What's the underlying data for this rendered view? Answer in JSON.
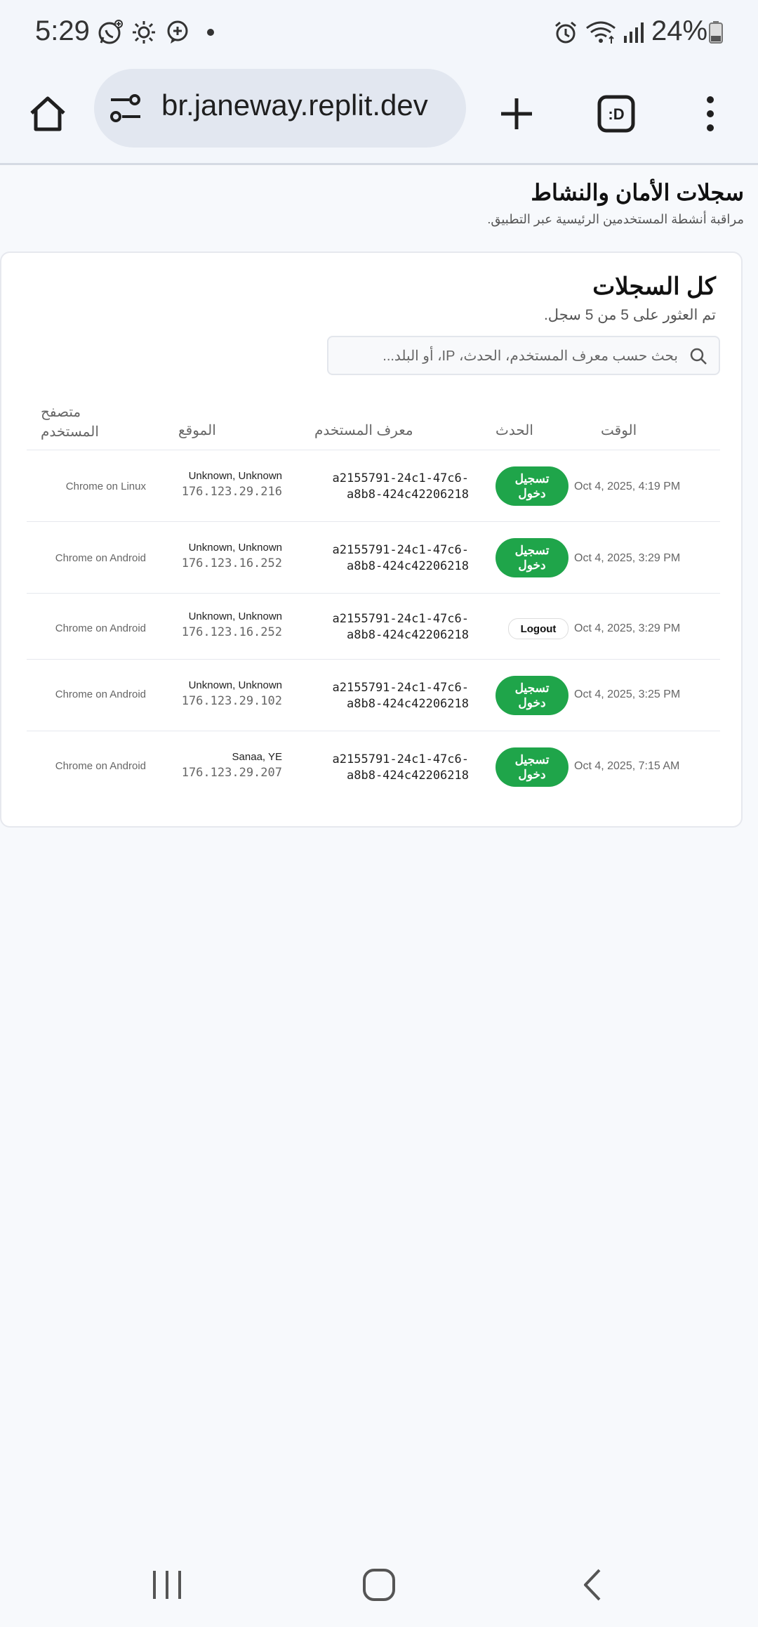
{
  "status_bar": {
    "time": "5:29",
    "battery": "24%",
    "icons": [
      "whatsapp-icon",
      "brightness-icon",
      "chat-plus-icon",
      "dot-icon",
      "alarm-icon",
      "wifi-icon",
      "signal-icon",
      "battery-icon"
    ]
  },
  "browser": {
    "url": "br.janeway.replit.dev",
    "icons": [
      "home-icon",
      "site-settings-icon",
      "new-tab-icon",
      "tab-switcher-icon",
      "more-menu-icon"
    ]
  },
  "page": {
    "title": "سجلات الأمان والنشاط",
    "subtitle": "مراقبة أنشطة المستخدمين الرئيسية عبر التطبيق."
  },
  "card": {
    "title": "كل السجلات",
    "description": "تم العثور على 5 من 5 سجل.",
    "search_placeholder": "بحث حسب معرف المستخدم، الحدث، IP، أو البلد..."
  },
  "table": {
    "headers": {
      "time": "الوقت",
      "event": "الحدث",
      "user_id": "معرف المستخدم",
      "location": "الموقع",
      "browser_line1": "متصفح",
      "browser_line2": "المستخدم"
    },
    "rows": [
      {
        "time": "Oct 4, 2025, 4:19 PM",
        "event_line1": "تسجيل",
        "event_line2": "دخول",
        "user_line1": "a2155791-24c1-47c6-",
        "user_line2": "a8b8-424c42206218",
        "location": "Unknown, Unknown",
        "ip": "176.123.29.216",
        "browser": "Chrome on Linux"
      },
      {
        "time": "Oct 4, 2025, 3:29 PM",
        "event_line1": "تسجيل",
        "event_line2": "دخول",
        "user_line1": "a2155791-24c1-47c6-",
        "user_line2": "a8b8-424c42206218",
        "location": "Unknown, Unknown",
        "ip": "176.123.16.252",
        "browser": "Chrome on Android"
      },
      {
        "time": "Oct 4, 2025, 3:29 PM",
        "event_line1": "Logout",
        "event_line2": "",
        "user_line1": "a2155791-24c1-47c6-",
        "user_line2": "a8b8-424c42206218",
        "location": "Unknown, Unknown",
        "ip": "176.123.16.252",
        "browser": "Chrome on Android"
      },
      {
        "time": "Oct 4, 2025, 3:25 PM",
        "event_line1": "تسجيل",
        "event_line2": "دخول",
        "user_line1": "a2155791-24c1-47c6-",
        "user_line2": "a8b8-424c42206218",
        "location": "Unknown, Unknown",
        "ip": "176.123.29.102",
        "browser": "Chrome on Android"
      },
      {
        "time": "Oct 4, 2025, 7:15 AM",
        "event_line1": "تسجيل",
        "event_line2": "دخول",
        "user_line1": "a2155791-24c1-47c6-",
        "user_line2": "a8b8-424c42206218",
        "location": "Sanaa, YE",
        "ip": "176.123.29.207",
        "browser": "Chrome on Android"
      }
    ]
  },
  "nav_bar": {
    "icons": [
      "recent-apps-icon",
      "home-nav-icon",
      "back-icon"
    ]
  },
  "colors": {
    "login_badge": "#1fa54a",
    "background": "#f7f9fc",
    "card": "#ffffff"
  }
}
